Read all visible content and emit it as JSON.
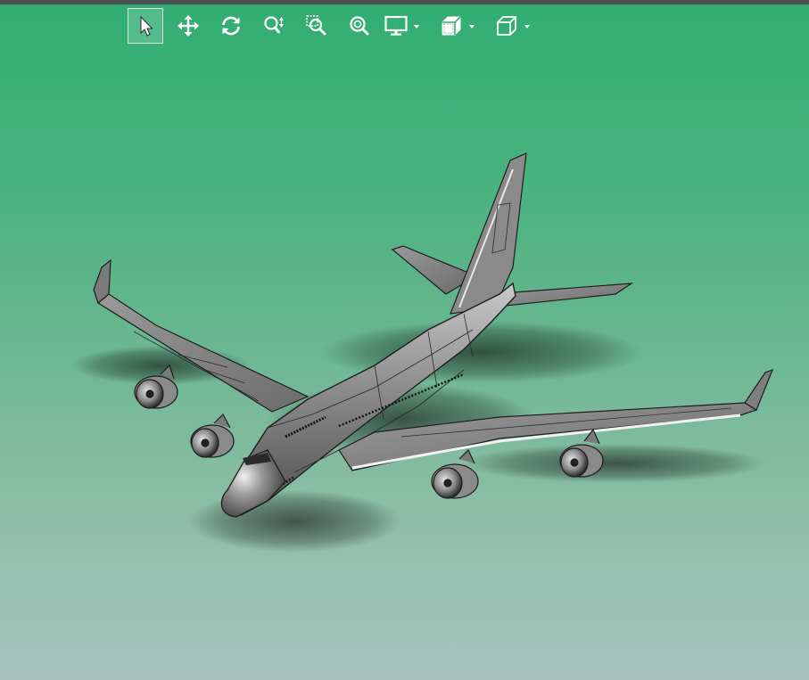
{
  "toolbar": {
    "tools": [
      {
        "id": "select",
        "icon": "select-arrow-icon",
        "active": true
      },
      {
        "id": "pan",
        "icon": "pan-move-icon",
        "active": false
      },
      {
        "id": "rotate",
        "icon": "rotate-icon",
        "active": false
      },
      {
        "id": "zoom-dynamic",
        "icon": "zoom-updown-icon",
        "active": false
      },
      {
        "id": "zoom-window",
        "icon": "zoom-window-icon",
        "active": false
      },
      {
        "id": "zoom-fit",
        "icon": "zoom-fit-icon",
        "active": false
      },
      {
        "id": "display-mode",
        "icon": "monitor-icon",
        "has_dropdown": true
      },
      {
        "id": "render-style",
        "icon": "shaded-cube-icon",
        "has_dropdown": true
      },
      {
        "id": "view-orientation",
        "icon": "wireframe-cube-icon",
        "has_dropdown": true
      }
    ]
  },
  "viewport": {
    "model": "airplane-3d-model",
    "background_top": "#31ad72",
    "background_bottom": "#a6c3bd",
    "model_color": "#8e8e8e"
  }
}
